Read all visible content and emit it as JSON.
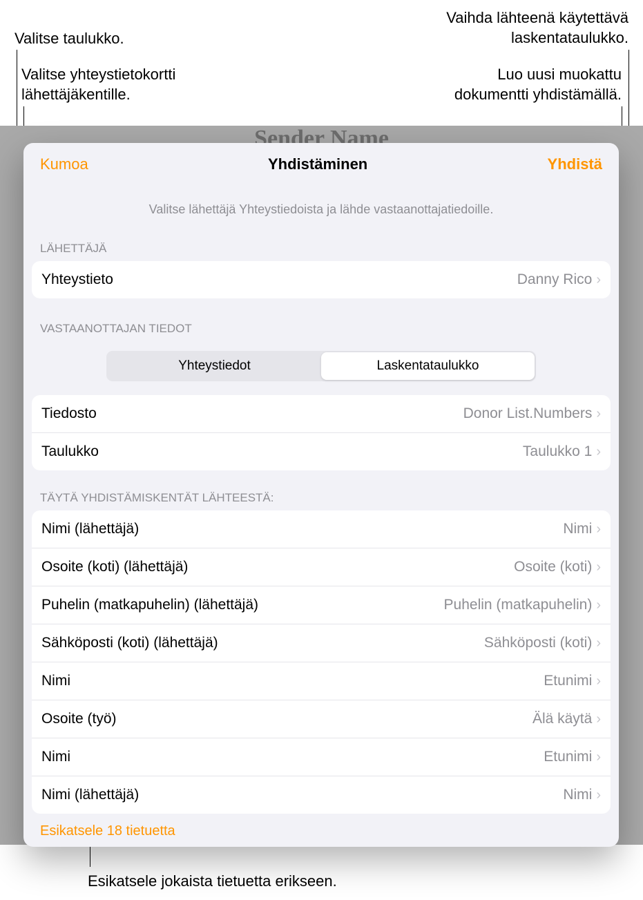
{
  "callouts": {
    "top_left_1": "Valitse taulukko.",
    "top_left_2_line1": "Valitse yhteystietokortti",
    "top_left_2_line2": "lähettäjäkentille.",
    "top_right_1_line1": "Vaihda lähteenä käytettävä",
    "top_right_1_line2": "laskentataulukko.",
    "top_right_2_line1": "Luo uusi muokattu",
    "top_right_2_line2": "dokumentti yhdistämällä.",
    "bottom": "Esikatsele jokaista tietuetta erikseen."
  },
  "background_title": "Sender Name",
  "header": {
    "cancel": "Kumoa",
    "title": "Yhdistäminen",
    "merge": "Yhdistä"
  },
  "subtitle": "Valitse lähettäjä Yhteystiedoista ja lähde vastaanottajatiedoille.",
  "sections": {
    "sender": "LÄHETTÄJÄ",
    "recipient": "VASTAANOTTAJAN TIEDOT",
    "fields": "TÄYTÄ YHDISTÄMISKENTÄT LÄHTEESTÄ:"
  },
  "sender_row": {
    "label": "Yhteystieto",
    "value": "Danny Rico"
  },
  "segments": {
    "contacts": "Yhteystiedot",
    "spreadsheet": "Laskentataulukko"
  },
  "source_rows": [
    {
      "label": "Tiedosto",
      "value": "Donor List.Numbers"
    },
    {
      "label": "Taulukko",
      "value": "Taulukko 1"
    }
  ],
  "field_rows": [
    {
      "label": "Nimi (lähettäjä)",
      "value": "Nimi"
    },
    {
      "label": "Osoite (koti) (lähettäjä)",
      "value": "Osoite (koti)"
    },
    {
      "label": "Puhelin (matkapuhelin) (lähettäjä)",
      "value": "Puhelin (matkapuhelin)"
    },
    {
      "label": "Sähköposti (koti) (lähettäjä)",
      "value": "Sähköposti (koti)"
    },
    {
      "label": "Nimi",
      "value": "Etunimi"
    },
    {
      "label": "Osoite (työ)",
      "value": "Älä käytä"
    },
    {
      "label": "Nimi",
      "value": "Etunimi"
    },
    {
      "label": "Nimi (lähettäjä)",
      "value": "Nimi"
    }
  ],
  "preview": "Esikatsele 18 tietuetta"
}
